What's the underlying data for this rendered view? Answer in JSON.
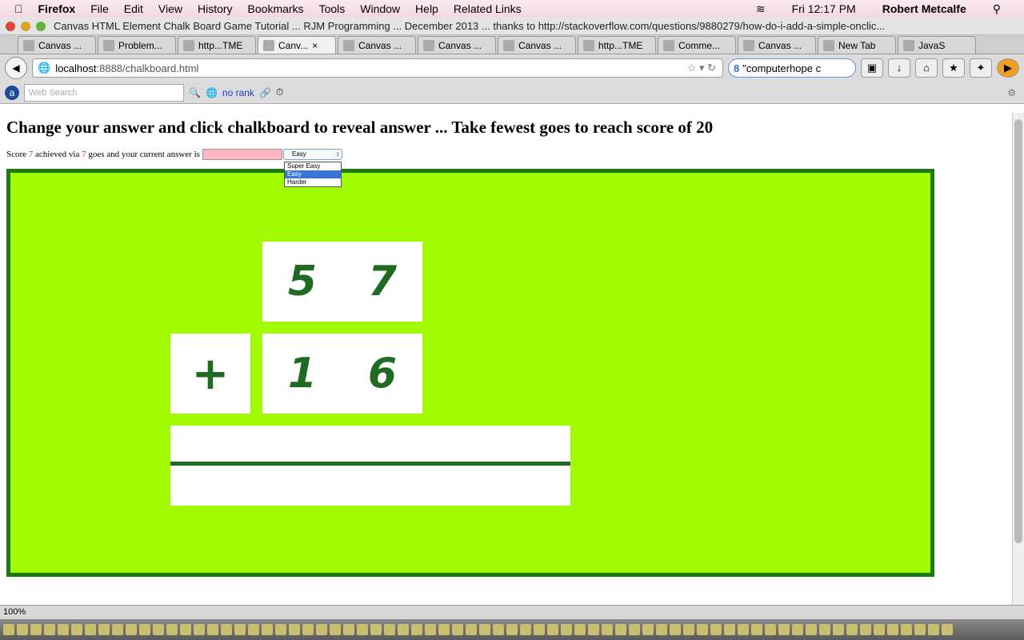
{
  "menubar": {
    "app": "Firefox",
    "items": [
      "File",
      "Edit",
      "View",
      "History",
      "Bookmarks",
      "Tools",
      "Window",
      "Help",
      "Related Links"
    ],
    "clock": "Fri 12:17 PM",
    "user": "Robert Metcalfe"
  },
  "window": {
    "title": "Canvas HTML Element Chalk Board Game Tutorial ... RJM Programming ... December 2013 ... thanks to http://stackoverflow.com/questions/9880279/how-do-i-add-a-simple-onclic..."
  },
  "tabs": [
    "Canvas ...",
    "Problem...",
    "http...TME",
    "Canv...",
    "Canvas ...",
    "Canvas ...",
    "Canvas ...",
    "http...TME",
    "Comme...",
    "Canvas ...",
    "New Tab",
    "JavaS"
  ],
  "nav": {
    "url_host": "localhost",
    "url_path": ":8888/chalkboard.html",
    "search": "\"computerhope c"
  },
  "toolbar2": {
    "search_placeholder": "Web Search",
    "rank": "no rank"
  },
  "page": {
    "heading": "Change your answer and click chalkboard to reveal answer ... Take fewest goes to reach score of 20",
    "score_prefix": "Score ",
    "score": "7",
    "via": " achieved via ",
    "goes": "7",
    "suffix": " goes and your current answer is",
    "answer": "",
    "difficulty": "Easy",
    "options": [
      "Super Easy",
      "Easy",
      "Harder"
    ]
  },
  "board": {
    "top_digits": [
      "5",
      "7"
    ],
    "operator": "+",
    "bottom_digits": [
      "1",
      "6"
    ]
  },
  "status": {
    "zoom": "100%"
  },
  "colors": {
    "board": "#a2fa00",
    "border": "#1a7a10",
    "digits": "#1f6b23",
    "answer_bg": "#ffb6c1"
  }
}
